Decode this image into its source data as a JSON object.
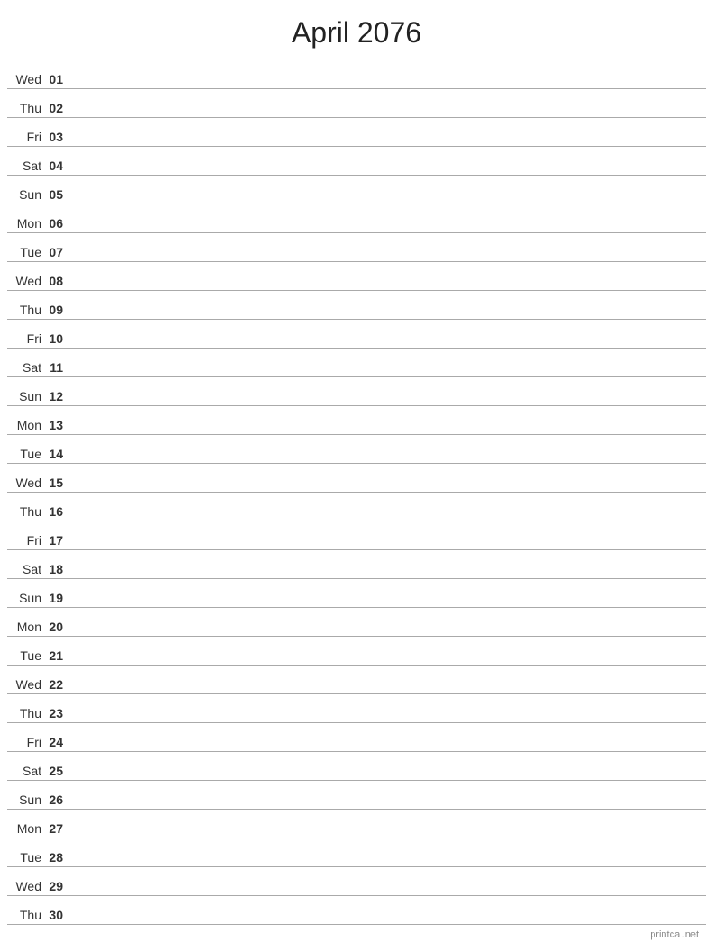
{
  "header": {
    "title": "April 2076"
  },
  "days": [
    {
      "name": "Wed",
      "num": "01"
    },
    {
      "name": "Thu",
      "num": "02"
    },
    {
      "name": "Fri",
      "num": "03"
    },
    {
      "name": "Sat",
      "num": "04"
    },
    {
      "name": "Sun",
      "num": "05"
    },
    {
      "name": "Mon",
      "num": "06"
    },
    {
      "name": "Tue",
      "num": "07"
    },
    {
      "name": "Wed",
      "num": "08"
    },
    {
      "name": "Thu",
      "num": "09"
    },
    {
      "name": "Fri",
      "num": "10"
    },
    {
      "name": "Sat",
      "num": "11"
    },
    {
      "name": "Sun",
      "num": "12"
    },
    {
      "name": "Mon",
      "num": "13"
    },
    {
      "name": "Tue",
      "num": "14"
    },
    {
      "name": "Wed",
      "num": "15"
    },
    {
      "name": "Thu",
      "num": "16"
    },
    {
      "name": "Fri",
      "num": "17"
    },
    {
      "name": "Sat",
      "num": "18"
    },
    {
      "name": "Sun",
      "num": "19"
    },
    {
      "name": "Mon",
      "num": "20"
    },
    {
      "name": "Tue",
      "num": "21"
    },
    {
      "name": "Wed",
      "num": "22"
    },
    {
      "name": "Thu",
      "num": "23"
    },
    {
      "name": "Fri",
      "num": "24"
    },
    {
      "name": "Sat",
      "num": "25"
    },
    {
      "name": "Sun",
      "num": "26"
    },
    {
      "name": "Mon",
      "num": "27"
    },
    {
      "name": "Tue",
      "num": "28"
    },
    {
      "name": "Wed",
      "num": "29"
    },
    {
      "name": "Thu",
      "num": "30"
    }
  ],
  "footer": {
    "text": "printcal.net"
  }
}
